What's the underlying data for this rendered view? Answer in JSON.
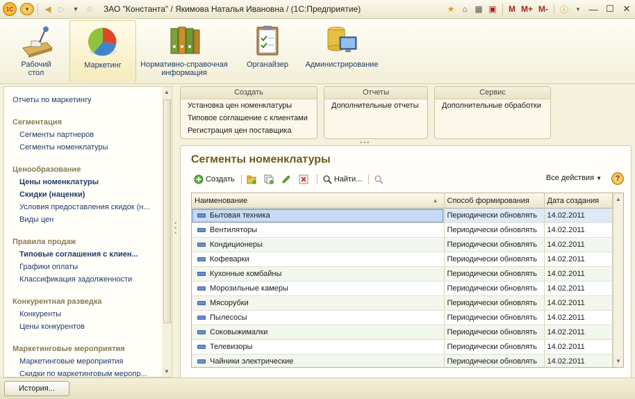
{
  "window": {
    "title": "ЗАО \"Константа\" / Якимова Наталья Ивановна / (1С:Предприятие)",
    "m_labels": [
      "M",
      "M+",
      "M-"
    ]
  },
  "sections": [
    {
      "label": "Рабочий стол",
      "icon": "desk-icon"
    },
    {
      "label": "Маркетинг",
      "icon": "pie-chart-icon",
      "active": true
    },
    {
      "label": "Нормативно-справочная информация",
      "icon": "binders-icon"
    },
    {
      "label": "Органайзер",
      "icon": "clipboard-icon"
    },
    {
      "label": "Администрирование",
      "icon": "database-monitor-icon"
    }
  ],
  "nav": {
    "top": "Отчеты по маркетингу",
    "groups": [
      {
        "title": "Сегментация",
        "items": [
          {
            "label": "Сегменты партнеров"
          },
          {
            "label": "Сегменты номенклатуры"
          }
        ]
      },
      {
        "title": "Ценообразование",
        "items": [
          {
            "label": "Цены номенклатуры",
            "bold": true
          },
          {
            "label": "Скидки (наценки)",
            "bold": true
          },
          {
            "label": "Условия предоставления скидок (н..."
          },
          {
            "label": "Виды цен"
          }
        ]
      },
      {
        "title": "Правила продаж",
        "items": [
          {
            "label": "Типовые соглашения с клиен...",
            "bold": true
          },
          {
            "label": "Графики оплаты"
          },
          {
            "label": "Классификация задолженности"
          }
        ]
      },
      {
        "title": "Конкурентная разведка",
        "items": [
          {
            "label": "Конкуренты"
          },
          {
            "label": "Цены конкурентов"
          }
        ]
      },
      {
        "title": "Маркетинговые мероприятия",
        "items": [
          {
            "label": "Маркетинговые мероприятия"
          },
          {
            "label": "Скидки по маркетинговым меропр..."
          }
        ]
      }
    ]
  },
  "commands": {
    "create": {
      "title": "Создать",
      "items": [
        "Установка цен номенклатуры",
        "Типовое соглашение с клиентами",
        "Регистрация цен поставщика"
      ]
    },
    "reports": {
      "title": "Отчеты",
      "items": [
        "Дополнительные отчеты"
      ]
    },
    "service": {
      "title": "Сервис",
      "items": [
        "Дополнительные обработки"
      ]
    }
  },
  "form": {
    "title": "Сегменты номенклатуры",
    "toolbar": {
      "create": "Создать",
      "find": "Найти...",
      "all_actions": "Все действия"
    },
    "columns": [
      "Наименование",
      "Способ формирования",
      "Дата создания"
    ],
    "rows": [
      [
        "Бытовая техника",
        "Периодически обновлять",
        "14.02.2011"
      ],
      [
        "Вентиляторы",
        "Периодически обновлять",
        "14.02.2011"
      ],
      [
        "Кондиционеры",
        "Периодически обновлять",
        "14.02.2011"
      ],
      [
        "Кофеварки",
        "Периодически обновлять",
        "14.02.2011"
      ],
      [
        "Кухонные комбайны",
        "Периодически обновлять",
        "14.02.2011"
      ],
      [
        "Морозильные камеры",
        "Периодически обновлять",
        "14.02.2011"
      ],
      [
        "Мясорубки",
        "Периодически обновлять",
        "14.02.2011"
      ],
      [
        "Пылесосы",
        "Периодически обновлять",
        "14.02.2011"
      ],
      [
        "Соковыжималки",
        "Периодически обновлять",
        "14.02.2011"
      ],
      [
        "Телевизоры",
        "Периодически обновлять",
        "14.02.2011"
      ],
      [
        "Чайники электрические",
        "Периодически обновлять",
        "14.02.2011"
      ]
    ]
  },
  "status": {
    "history_button": "История..."
  }
}
